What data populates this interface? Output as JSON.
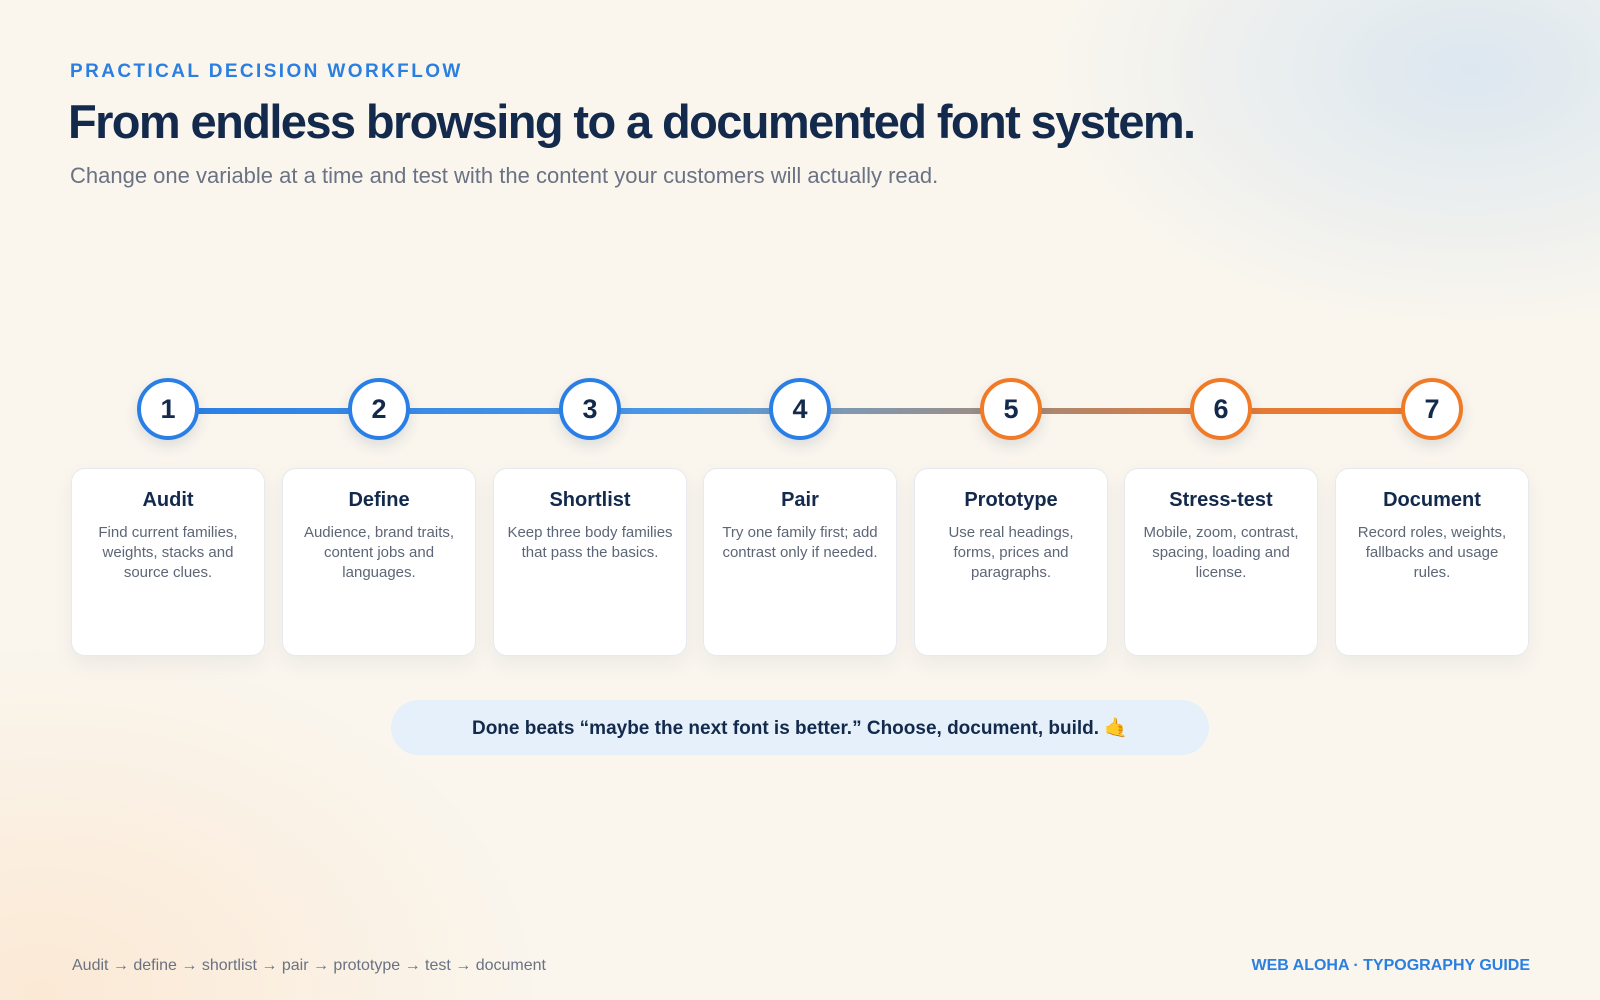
{
  "header": {
    "eyebrow": "PRACTICAL DECISION WORKFLOW",
    "title": "From endless browsing to a documented font system.",
    "subtitle": "Change one variable at a time and test with the content your customers will actually read."
  },
  "steps": [
    {
      "number": "1",
      "title": "Audit",
      "description": "Find current families, weights, stacks and source clues.",
      "accent": "#2a7fe6"
    },
    {
      "number": "2",
      "title": "Define",
      "description": "Audience, brand traits, content jobs and languages.",
      "accent": "#2a7fe6"
    },
    {
      "number": "3",
      "title": "Shortlist",
      "description": "Keep three body families that pass the basics.",
      "accent": "#2a7fe6"
    },
    {
      "number": "4",
      "title": "Pair",
      "description": "Try one family first; add contrast only if needed.",
      "accent": "#2a7fe6"
    },
    {
      "number": "5",
      "title": "Prototype",
      "description": "Use real headings, forms, prices and paragraphs.",
      "accent": "#f07a26"
    },
    {
      "number": "6",
      "title": "Stress-test",
      "description": "Mobile, zoom, contrast, spacing, loading and license.",
      "accent": "#f07a26"
    },
    {
      "number": "7",
      "title": "Document",
      "description": "Record roles, weights, fallbacks and usage rules.",
      "accent": "#f07a26"
    }
  ],
  "callout": "Done beats “maybe the next font is better.” Choose, document, build. 🤙",
  "footer": {
    "flow": "Audit → define → shortlist → pair → prototype → test → document",
    "brand": "WEB ALOHA · TYPOGRAPHY GUIDE"
  },
  "colors": {
    "blue": "#2a7fe6",
    "orange": "#f07a26",
    "navy": "#132a4c"
  }
}
